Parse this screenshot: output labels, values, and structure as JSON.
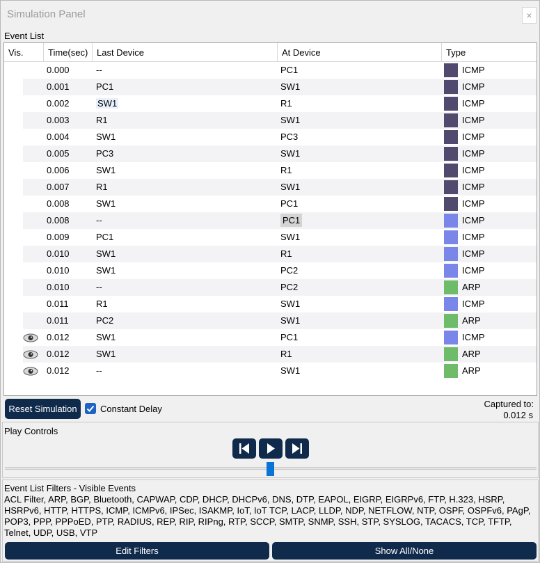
{
  "window": {
    "title": "Simulation Panel",
    "close_glyph": "×"
  },
  "event_list": {
    "label": "Event List",
    "columns": {
      "vis": "Vis.",
      "time": "Time(sec)",
      "last": "Last Device",
      "at": "At Device",
      "type": "Type"
    },
    "colors": {
      "icmp_dark": "#524a6e",
      "icmp_light": "#7a86e8",
      "arp": "#6ebc6a"
    },
    "rows": [
      {
        "vis": false,
        "time": "0.000",
        "last": "--",
        "at": "PC1",
        "type": "ICMP",
        "color": "#524a6e"
      },
      {
        "vis": false,
        "time": "0.001",
        "last": "PC1",
        "at": "SW1",
        "type": "ICMP",
        "color": "#524a6e"
      },
      {
        "vis": false,
        "time": "0.002",
        "last": "SW1",
        "at": "R1",
        "type": "ICMP",
        "color": "#524a6e"
      },
      {
        "vis": false,
        "time": "0.003",
        "last": "R1",
        "at": "SW1",
        "type": "ICMP",
        "color": "#524a6e"
      },
      {
        "vis": false,
        "time": "0.004",
        "last": "SW1",
        "at": "PC3",
        "type": "ICMP",
        "color": "#524a6e"
      },
      {
        "vis": false,
        "time": "0.005",
        "last": "PC3",
        "at": "SW1",
        "type": "ICMP",
        "color": "#524a6e"
      },
      {
        "vis": false,
        "time": "0.006",
        "last": "SW1",
        "at": "R1",
        "type": "ICMP",
        "color": "#524a6e"
      },
      {
        "vis": false,
        "time": "0.007",
        "last": "R1",
        "at": "SW1",
        "type": "ICMP",
        "color": "#524a6e"
      },
      {
        "vis": false,
        "time": "0.008",
        "last": "SW1",
        "at": "PC1",
        "type": "ICMP",
        "color": "#524a6e"
      },
      {
        "vis": false,
        "time": "0.008",
        "last": "--",
        "at": "PC1",
        "type": "ICMP",
        "color": "#7a86e8"
      },
      {
        "vis": false,
        "time": "0.009",
        "last": "PC1",
        "at": "SW1",
        "type": "ICMP",
        "color": "#7a86e8"
      },
      {
        "vis": false,
        "time": "0.010",
        "last": "SW1",
        "at": "R1",
        "type": "ICMP",
        "color": "#7a86e8"
      },
      {
        "vis": false,
        "time": "0.010",
        "last": "SW1",
        "at": "PC2",
        "type": "ICMP",
        "color": "#7a86e8"
      },
      {
        "vis": false,
        "time": "0.010",
        "last": "--",
        "at": "PC2",
        "type": "ARP",
        "color": "#6ebc6a"
      },
      {
        "vis": false,
        "time": "0.011",
        "last": "R1",
        "at": "SW1",
        "type": "ICMP",
        "color": "#7a86e8"
      },
      {
        "vis": false,
        "time": "0.011",
        "last": "PC2",
        "at": "SW1",
        "type": "ARP",
        "color": "#6ebc6a"
      },
      {
        "vis": true,
        "time": "0.012",
        "last": "SW1",
        "at": "PC1",
        "type": "ICMP",
        "color": "#7a86e8"
      },
      {
        "vis": true,
        "time": "0.012",
        "last": "SW1",
        "at": "R1",
        "type": "ARP",
        "color": "#6ebc6a"
      },
      {
        "vis": true,
        "time": "0.012",
        "last": "--",
        "at": "SW1",
        "type": "ARP",
        "color": "#6ebc6a"
      }
    ]
  },
  "controls": {
    "reset_label": "Reset Simulation",
    "constant_delay_label": "Constant Delay",
    "constant_delay_checked": true,
    "captured_label": "Captured to:",
    "captured_value": "0.012 s"
  },
  "play": {
    "label": "Play Controls",
    "back_icon": "skip-back-icon",
    "play_icon": "play-icon",
    "forward_icon": "skip-forward-icon",
    "slider_position": 0.5
  },
  "filters": {
    "label": "Event List Filters - Visible Events",
    "text": "ACL Filter, ARP, BGP, Bluetooth, CAPWAP, CDP, DHCP, DHCPv6, DNS, DTP, EAPOL, EIGRP, EIGRPv6, FTP, H.323, HSRP, HSRPv6, HTTP, HTTPS, ICMP, ICMPv6, IPSec, ISAKMP, IoT, IoT TCP, LACP, LLDP, NDP, NETFLOW, NTP, OSPF, OSPFv6, PAgP, POP3, PPP, PPPoED, PTP, RADIUS, REP, RIP, RIPng, RTP, SCCP, SMTP, SNMP, SSH, STP, SYSLOG, TACACS, TCP, TFTP, Telnet, UDP, USB, VTP",
    "edit_label": "Edit Filters",
    "show_all_label": "Show All/None"
  }
}
